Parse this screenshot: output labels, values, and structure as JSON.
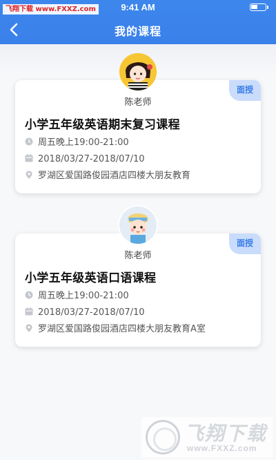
{
  "status_bar": {
    "time": "9:41 AM",
    "watermark": "飞翔下载 www.FXXZ.com"
  },
  "nav": {
    "title": "我的课程",
    "back_icon": "chevron-left-icon"
  },
  "courses": [
    {
      "teacher": "陈老师",
      "badge": "面授",
      "title": "小学五年级英语期末复习课程",
      "time": "周五晚上19:00-21:00",
      "date": "2018/03/27-2018/07/10",
      "address": "罗湖区爱国路俊园酒店四楼大朋友教育"
    },
    {
      "teacher": "陈老师",
      "badge": "面授",
      "title": "小学五年级英语口语课程",
      "time": "周五晚上19:00-21:00",
      "date": "2018/03/27-2018/07/10",
      "address": "罗湖区爱国路俊园酒店四楼大朋友教育A室"
    }
  ],
  "watermark_bottom": {
    "text": "飞翔下载",
    "url": "www.FXXZ.com"
  },
  "colors": {
    "header": "#3a80ea",
    "badge_bg": "#c9dcfb",
    "badge_text": "#3a7ee8"
  }
}
